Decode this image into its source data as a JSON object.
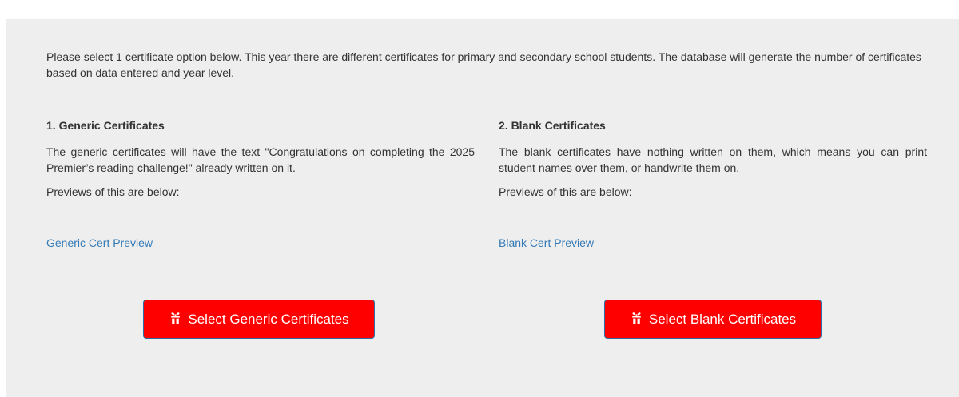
{
  "intro": {
    "text": "Please select 1 certificate option below. This year there are different certificates for primary and secondary school students. The database will generate the number of certificates based on data entered and year level."
  },
  "generic": {
    "heading": "1. Generic Certificates",
    "description": "The generic certificates will have the text \"Congratulations on completing the 2025 Premier’s reading challenge!\" already written on it.",
    "previews_text": "Previews of this are below:",
    "preview_link": "Generic Cert Preview",
    "button_label": "Select Generic Certificates",
    "button_icon": "gift-icon"
  },
  "blank": {
    "heading": "2. Blank Certificates",
    "description": "The blank certificates have nothing written on them, which means you can print student names over them, or handwrite them on.",
    "previews_text": "Previews of this are below:",
    "preview_link": "Blank Cert Preview",
    "button_label": "Select Blank Certificates",
    "button_icon": "gift-icon"
  },
  "colors": {
    "panel_background": "#eeeeee",
    "button_background": "#ff0000",
    "link": "#337ab7",
    "text": "#333333"
  }
}
